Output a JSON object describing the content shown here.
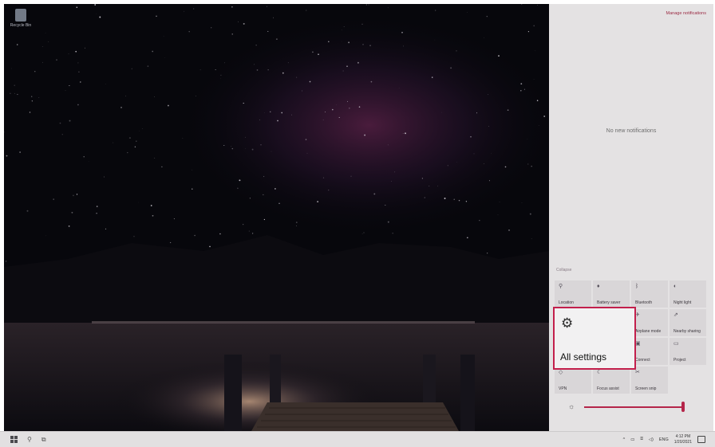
{
  "desktop": {
    "recycle_bin_label": "Recycle Bin"
  },
  "action_center": {
    "manage_notifications": "Manage notifications",
    "no_notifications": "No new notifications",
    "collapse": "Collapse",
    "tiles": [
      {
        "label": "Location",
        "icon": "location-icon",
        "glyph": "⚲"
      },
      {
        "label": "Battery saver",
        "icon": "battery-saver-icon",
        "glyph": "♦"
      },
      {
        "label": "Bluetooth",
        "icon": "bluetooth-icon",
        "glyph": "ᛒ"
      },
      {
        "label": "Night light",
        "icon": "night-light-icon",
        "glyph": "◐"
      },
      {
        "label": "All settings",
        "icon": "gear-icon",
        "glyph": "⚙"
      },
      {
        "label": "",
        "icon": "mobile-hotspot-icon",
        "glyph": ""
      },
      {
        "label": "Airplane mode",
        "icon": "airplane-icon",
        "glyph": "✈"
      },
      {
        "label": "Nearby sharing",
        "icon": "nearby-sharing-icon",
        "glyph": "⇗"
      },
      {
        "label": "",
        "icon": "network-icon",
        "glyph": ""
      },
      {
        "label": "",
        "icon": "wifi-icon",
        "glyph": ""
      },
      {
        "label": "Connect",
        "icon": "connect-icon",
        "glyph": "▣"
      },
      {
        "label": "Project",
        "icon": "project-icon",
        "glyph": "▭"
      },
      {
        "label": "VPN",
        "icon": "vpn-icon",
        "glyph": "◇"
      },
      {
        "label": "Focus assist",
        "icon": "focus-assist-icon",
        "glyph": "☾"
      },
      {
        "label": "Screen snip",
        "icon": "screen-snip-icon",
        "glyph": "✂"
      }
    ],
    "all_settings_label": "All settings",
    "brightness_level": 0.97
  },
  "taskbar": {
    "language": "ENG",
    "time": "4:12 PM",
    "date": "1/20/2021"
  },
  "colors": {
    "accent": "#c31f4c",
    "panel": "#e4e2e3"
  }
}
